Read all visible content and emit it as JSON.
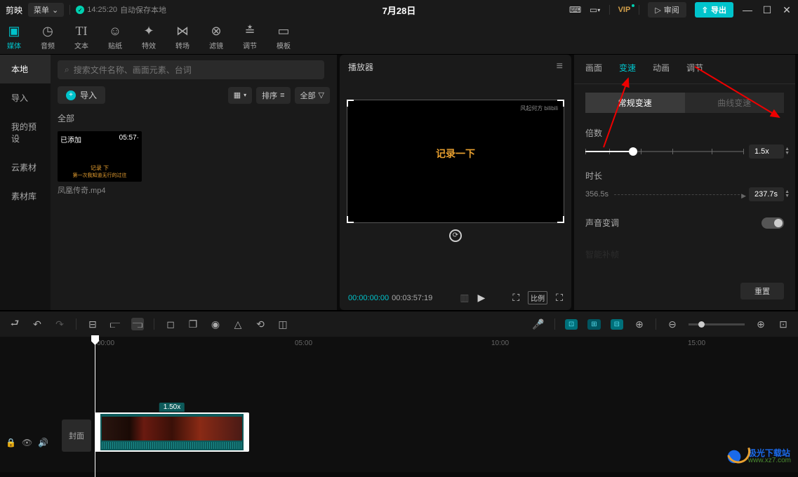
{
  "titlebar": {
    "app_name": "剪映",
    "menu_label": "菜单",
    "save_time": "14:25:20",
    "save_text": "自动保存本地",
    "project_title": "7月28日",
    "vip_label": "VIP",
    "review_label": "审阅",
    "export_label": "导出"
  },
  "top_tabs": [
    {
      "icon": "▣",
      "label": "媒体"
    },
    {
      "icon": "◷",
      "label": "音频"
    },
    {
      "icon": "TI",
      "label": "文本"
    },
    {
      "icon": "☺",
      "label": "贴纸"
    },
    {
      "icon": "✦",
      "label": "特效"
    },
    {
      "icon": "⋈",
      "label": "转场"
    },
    {
      "icon": "⊗",
      "label": "滤镜"
    },
    {
      "icon": "≡",
      "label": "调节"
    },
    {
      "icon": "▭",
      "label": "模板"
    }
  ],
  "sidebar": {
    "items": [
      "本地",
      "导入",
      "我的预设",
      "云素材",
      "素材库"
    ]
  },
  "media": {
    "search_placeholder": "搜索文件名称、画面元素、台词",
    "import_label": "导入",
    "sort_label": "排序",
    "all_label": "全部",
    "section_label": "全部",
    "item": {
      "added": "已添加",
      "duration": "05:57·",
      "sub1": "记录  下",
      "sub2": "第一次我知道无行的过往",
      "filename": "凤凰传奇.mp4"
    }
  },
  "player": {
    "title": "播放器",
    "watermark": "风起何方 bilibili",
    "caption": "记录一下",
    "time_current": "00:00:00:00",
    "time_total": "00:03:57:19",
    "ratio_label": "比例"
  },
  "props": {
    "tabs": [
      "画面",
      "变速",
      "动画",
      "调节"
    ],
    "mode_tabs": [
      "常规变速",
      "曲线变速"
    ],
    "speed_label": "倍数",
    "speed_value": "1.5x",
    "duration_label": "时长",
    "duration_from": "356.5s",
    "duration_to": "237.7s",
    "pitch_label": "声音变调",
    "smart_label": "智能补帧",
    "reset_label": "重置"
  },
  "timeline": {
    "ruler": [
      "00:00",
      "05:00",
      "10:00",
      "15:00"
    ],
    "cover_label": "封面",
    "clip_speed": "1.50x"
  },
  "watermark": {
    "cn": "极光下载站",
    "url": "www.xz7.com"
  }
}
